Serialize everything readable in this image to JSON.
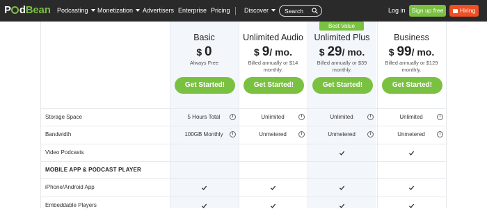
{
  "nav": {
    "logo_pod": "P",
    "logo_d": "d",
    "logo_bean": "Bean",
    "items": [
      {
        "label": "Podcasting",
        "dropdown": true
      },
      {
        "label": "Monetization",
        "dropdown": true
      },
      {
        "label": "Advertisers",
        "dropdown": false
      },
      {
        "label": "Enterprise",
        "dropdown": false
      },
      {
        "label": "Pricing",
        "dropdown": false
      },
      {
        "label": "Discover",
        "dropdown": true
      }
    ],
    "search_label": "Search",
    "login_label": "Log in",
    "signup_label": "Sign up free",
    "hiring_label": "Hiring",
    "colors": {
      "bar": "#2a2a2a",
      "green": "#7ac142",
      "orange": "#f04e23"
    }
  },
  "plans": [
    {
      "name": "Basic",
      "currency": "$",
      "amount": "0",
      "period": "",
      "subtitle": "Always Free",
      "cta": "Get Started!",
      "highlight": true
    },
    {
      "name": "Unlimited Audio",
      "currency": "$",
      "amount": "9",
      "period": "/ mo.",
      "subtitle": "Billed annually or $14 monthly.",
      "cta": "Get Started!",
      "highlight": false
    },
    {
      "name": "Unlimited Plus",
      "currency": "$",
      "amount": "29",
      "period": "/ mo.",
      "subtitle": "Billed annually or $39 monthly.",
      "cta": "Get Started!",
      "highlight": true,
      "badge": "Best Value"
    },
    {
      "name": "Business",
      "currency": "$",
      "amount": "99",
      "period": "/ mo.",
      "subtitle": "Billed annually or $129 monthly.",
      "cta": "Get Started!",
      "highlight": false
    }
  ],
  "rows": [
    {
      "label": "Storage Space",
      "type": "text",
      "values": [
        "5 Hours Total",
        "Unlimited",
        "Unlimited",
        "Unlimited"
      ],
      "info": true
    },
    {
      "label": "Bandwidth",
      "type": "text",
      "values": [
        "100GB Monthly",
        "Unmetered",
        "Unmetered",
        "Unmetered"
      ],
      "info": true
    },
    {
      "label": "Video Podcasts",
      "type": "check",
      "values": [
        false,
        false,
        true,
        true
      ],
      "info": false
    },
    {
      "label": "MOBILE APP & PODCAST PLAYER",
      "type": "section"
    },
    {
      "label": "iPhone/Android App",
      "type": "check",
      "values": [
        true,
        true,
        true,
        true
      ],
      "info": false
    },
    {
      "label": "Embeddable Players",
      "type": "check",
      "values": [
        true,
        true,
        true,
        true
      ],
      "info": false
    }
  ]
}
